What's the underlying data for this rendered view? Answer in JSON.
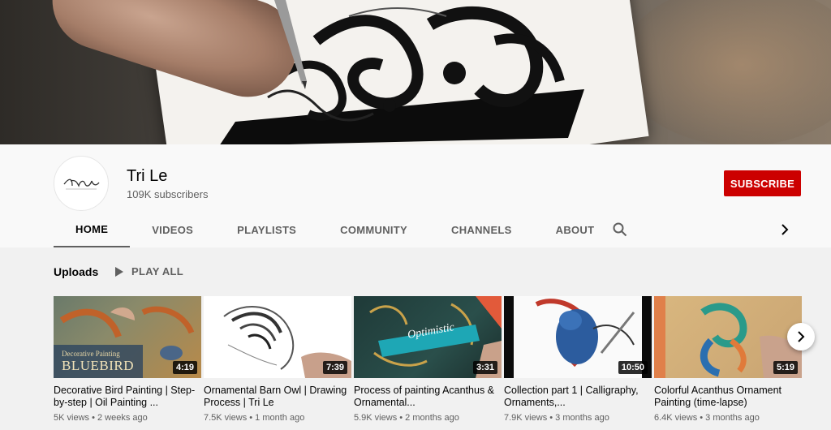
{
  "channel": {
    "name": "Tri Le",
    "subscribers": "109K subscribers",
    "subscribe_label": "SUBSCRIBE"
  },
  "tabs": [
    {
      "label": "HOME",
      "active": true
    },
    {
      "label": "VIDEOS"
    },
    {
      "label": "PLAYLISTS"
    },
    {
      "label": "COMMUNITY"
    },
    {
      "label": "CHANNELS"
    },
    {
      "label": "ABOUT"
    }
  ],
  "icons": {
    "tab_search": "search-icon",
    "tab_next": "chevron-right-icon",
    "play_all": "play-icon",
    "carousel_next": "chevron-right-icon"
  },
  "uploads": {
    "title": "Uploads",
    "play_all_label": "PLAY ALL",
    "videos": [
      {
        "duration": "4:19",
        "title": "Decorative Bird Painting | Step-by-step | Oil Painting ...",
        "views": "5K views",
        "age": "2 weeks ago",
        "thumb_text_1": "Decorative Painting",
        "thumb_text_2": "BLUEBIRD"
      },
      {
        "duration": "7:39",
        "title": "Ornamental Barn Owl | Drawing Process | Tri Le",
        "views": "7.5K views",
        "age": "1 month ago"
      },
      {
        "duration": "3:31",
        "title": "Process of painting Acanthus & Ornamental...",
        "views": "5.9K views",
        "age": "2 months ago",
        "thumb_text_1": "Optimistic"
      },
      {
        "duration": "10:50",
        "title": "Collection part 1 | Calligraphy, Ornaments,...",
        "views": "7.9K views",
        "age": "3 months ago"
      },
      {
        "duration": "5:19",
        "title": "Colorful Acanthus Ornament Painting (time-lapse)",
        "views": "6.4K views",
        "age": "3 months ago"
      }
    ]
  },
  "colors": {
    "subscribe": "#cc0000",
    "text_primary": "#030303",
    "text_secondary": "#606060"
  }
}
